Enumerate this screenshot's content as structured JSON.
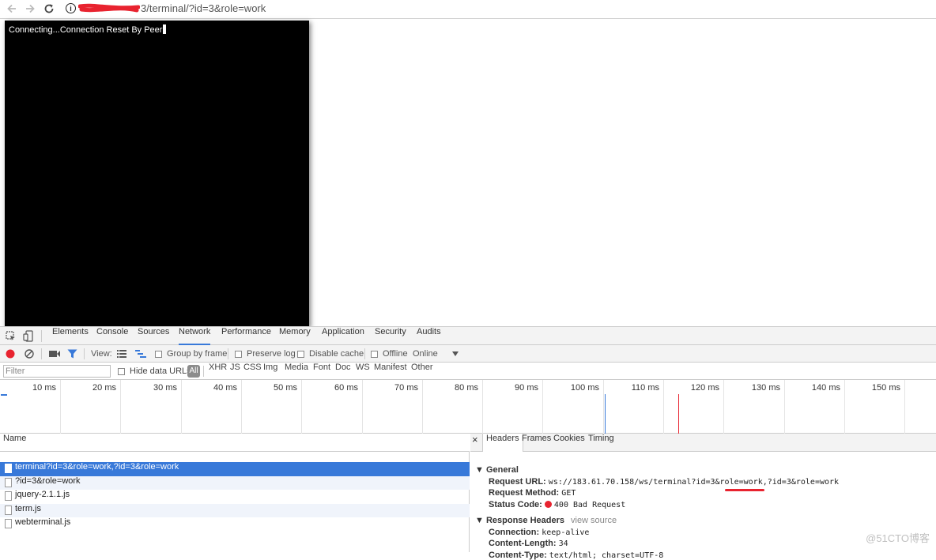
{
  "browser": {
    "url_suffix": "3/terminal/?id=3&role=work",
    "info_icon": "i"
  },
  "terminal": {
    "text": "Connecting...Connection Reset By Peer"
  },
  "devtools": {
    "tabs": [
      "Elements",
      "Console",
      "Sources",
      "Network",
      "Performance",
      "Memory",
      "Application",
      "Security",
      "Audits"
    ],
    "active_tab": "Network",
    "toolbar": {
      "view_label": "View:",
      "group_by_frame": "Group by frame",
      "preserve_log": "Preserve log",
      "disable_cache": "Disable cache",
      "offline": "Offline",
      "throttle": "Online"
    },
    "filter": {
      "placeholder": "Filter",
      "hide_data_urls": "Hide data URLs",
      "all": "All",
      "types": [
        "XHR",
        "JS",
        "CSS",
        "Img",
        "Media",
        "Font",
        "Doc",
        "WS",
        "Manifest",
        "Other"
      ]
    },
    "timeline": {
      "labels": [
        "10 ms",
        "20 ms",
        "30 ms",
        "40 ms",
        "50 ms",
        "60 ms",
        "70 ms",
        "80 ms",
        "90 ms",
        "100 ms",
        "110 ms",
        "120 ms",
        "130 ms",
        "140 ms",
        "150 ms"
      ],
      "dom_content_loaded_color": "#3879d9",
      "load_color": "#e8232f"
    },
    "requests": {
      "header": "Name",
      "rows": [
        "terminal?id=3&role=work,?id=3&role=work",
        "?id=3&role=work",
        "jquery-2.1.1.js",
        "term.js",
        "webterminal.js"
      ]
    },
    "details": {
      "close": "×",
      "tabs": [
        "Headers",
        "Frames",
        "Cookies",
        "Timing"
      ],
      "general": {
        "title": "General",
        "request_url_label": "Request URL:",
        "request_url_value": "ws://183.61.70.158/ws/terminal?id=3&role=work,?id=3&role=work",
        "request_method_label": "Request Method:",
        "request_method_value": "GET",
        "status_code_label": "Status Code:",
        "status_code_value": "400 Bad Request"
      },
      "response_headers": {
        "title": "Response Headers",
        "view_source": "view source",
        "connection_label": "Connection:",
        "connection_value": "keep-alive",
        "content_length_label": "Content-Length:",
        "content_length_value": "34",
        "content_type_label": "Content-Type:",
        "content_type_value": "text/html; charset=UTF-8"
      }
    }
  },
  "watermark": "@51CTO博客"
}
